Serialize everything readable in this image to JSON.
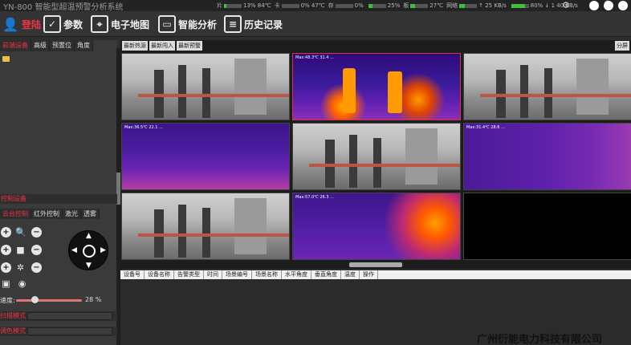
{
  "app": {
    "title": "YN-800 智能型超温预警分析系统"
  },
  "status": {
    "items": [
      {
        "label": "片",
        "value": "13%",
        "extra": "84℃",
        "fill": 0.13
      },
      {
        "label": "卡",
        "value": "0%",
        "extra": "47℃",
        "fill": 0.0
      },
      {
        "label": "存",
        "value": "0%",
        "extra": "",
        "fill": 0.0
      },
      {
        "label": "",
        "value": "25%",
        "extra": "",
        "fill": 0.25
      },
      {
        "label": "板",
        "value": "27℃",
        "extra": "",
        "fill": 0.27
      },
      {
        "label": "网络",
        "value": "↑ 25 KB/s",
        "extra": "",
        "fill": 0.3
      },
      {
        "label": "",
        "value": "80%",
        "extra": "↓ 1 40 KB/s",
        "fill": 0.8
      }
    ]
  },
  "menu": {
    "login": "登陆",
    "params": "参数",
    "map": "电子地图",
    "analysis": "智能分析",
    "history": "历史记录"
  },
  "left": {
    "tabs": [
      "前端设备",
      "高级",
      "预置位",
      "角度"
    ],
    "control_title": "控制设备",
    "control_tabs": [
      "云台控制",
      "红外控制",
      "激光",
      "透雾"
    ],
    "speed_label": "速度:",
    "speed_value": "28 %",
    "speed_fraction": 0.28,
    "scan_mode": "扫描模式",
    "color_mode": "调色模式"
  },
  "video": {
    "tabs": [
      "最新热源",
      "最新闯入",
      "最新预警"
    ],
    "split": "分屏",
    "tiles": [
      {
        "type": "photo",
        "ts": "",
        "selected": false
      },
      {
        "type": "thermal",
        "ts": "Max:48.3℃ 31.4 ...",
        "selected": true
      },
      {
        "type": "photo",
        "ts": "",
        "selected": false
      },
      {
        "type": "thermal2",
        "ts": "Max:36.5℃ 22.1 ...",
        "selected": false
      },
      {
        "type": "photo",
        "ts": "",
        "selected": false
      },
      {
        "type": "thermal3",
        "ts": "Max:31.4℃ 28.6 ...",
        "selected": false
      },
      {
        "type": "photo",
        "ts": "",
        "selected": false
      },
      {
        "type": "thermal4",
        "ts": "Max:57.0℃ 26.3 ...",
        "selected": false
      },
      {
        "type": "black",
        "ts": "",
        "selected": false
      }
    ]
  },
  "table": {
    "columns": [
      "设备号",
      "设备名称",
      "告警类型",
      "时间",
      "场景编号",
      "场景名称",
      "水平角度",
      "垂直角度",
      "温度",
      "操作"
    ]
  },
  "watermark": "广州衍能电力科技有限公司"
}
